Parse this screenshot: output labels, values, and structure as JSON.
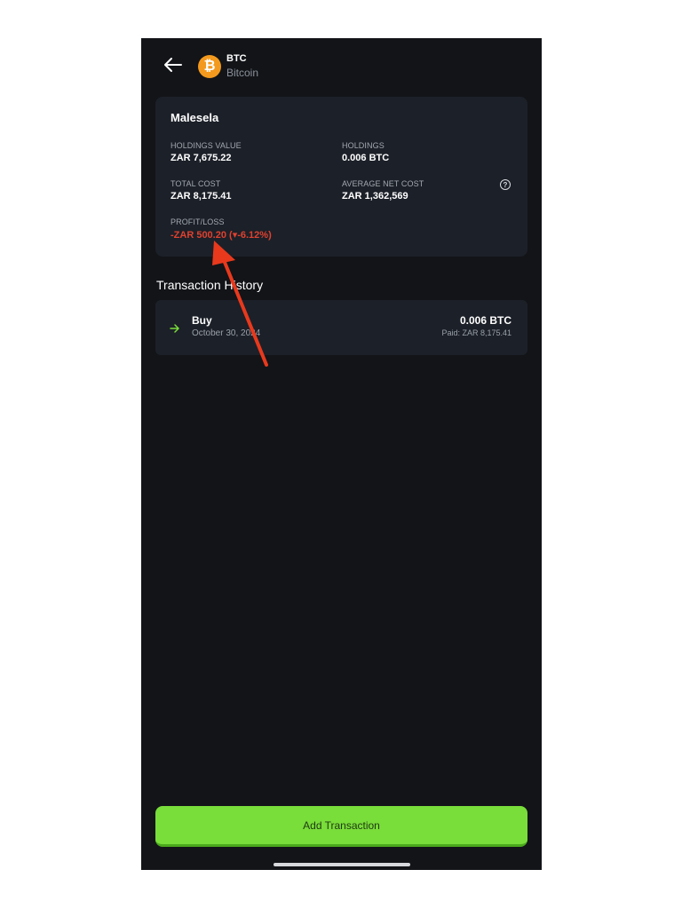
{
  "header": {
    "back_icon": "arrow-left-icon",
    "coin_icon": "bitcoin-icon",
    "coin_glyph": "₿",
    "coin_symbol": "BTC",
    "coin_name": "Bitcoin"
  },
  "summary": {
    "portfolio_name": "Malesela",
    "holdings_value_label": "HOLDINGS VALUE",
    "holdings_value": "ZAR 7,675.22",
    "holdings_label": "HOLDINGS",
    "holdings": "0.006 BTC",
    "total_cost_label": "TOTAL COST",
    "total_cost": "ZAR 8,175.41",
    "avg_net_cost_label": "AVERAGE NET COST",
    "avg_net_cost": "ZAR 1,362,569",
    "help_icon": "question-circle-icon",
    "help_glyph": "?",
    "profit_loss_label": "PROFIT/LOSS",
    "profit_loss": "-ZAR 500.20 (▾-6.12%)"
  },
  "transaction_history": {
    "title": "Transaction History",
    "items": [
      {
        "icon": "arrow-right-icon",
        "type": "Buy",
        "date": "October 30, 2024",
        "amount": "0.006 BTC",
        "paid": "Paid: ZAR 8,175.41"
      }
    ]
  },
  "footer": {
    "add_transaction_label": "Add Transaction"
  },
  "colors": {
    "background": "#121418",
    "card": "#1c2028",
    "accent_green": "#79dd3a",
    "loss_red": "#e0412f",
    "bitcoin_orange": "#f39a1e",
    "annotation_red": "#e8391d"
  }
}
